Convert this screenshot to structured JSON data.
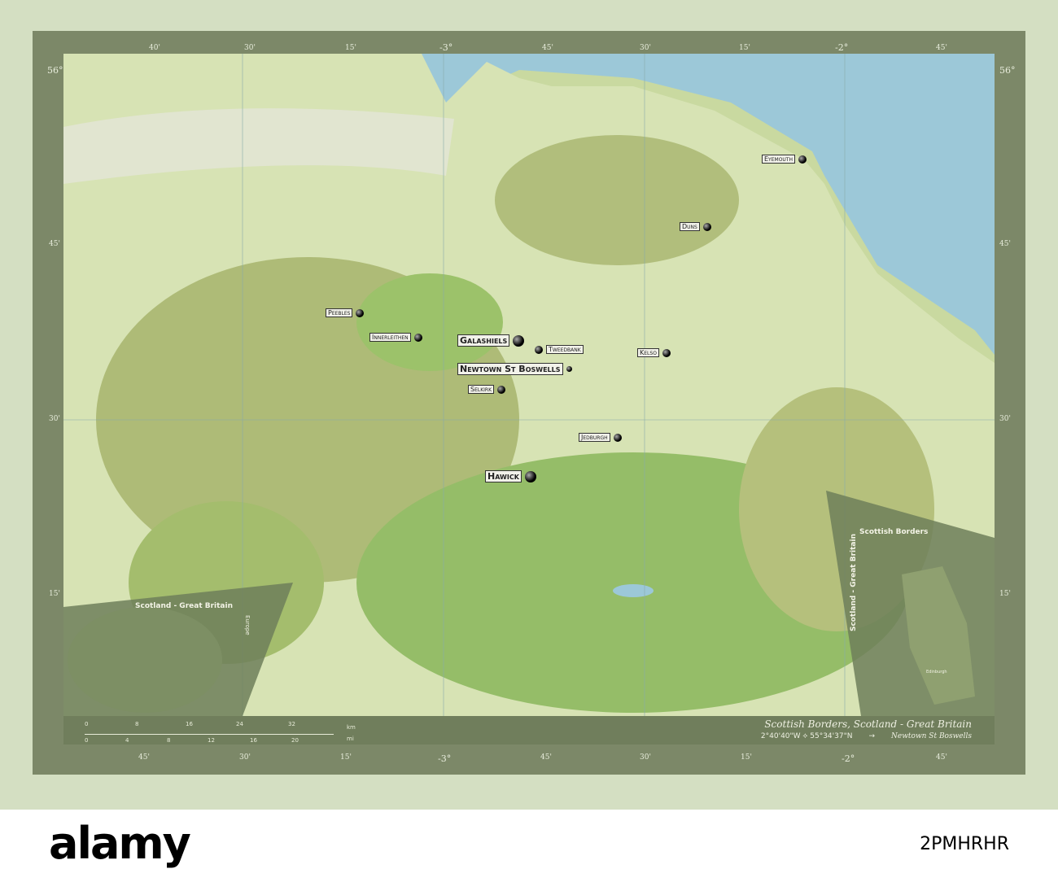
{
  "map": {
    "top_ticks": [
      "40'",
      "30'",
      "15'",
      "-3°",
      "45'",
      "30'",
      "15'",
      "-2°",
      "45'"
    ],
    "bottom_ticks": [
      "45'",
      "30'",
      "15'",
      "-3°",
      "45'",
      "30'",
      "15'",
      "-2°",
      "45'"
    ],
    "left_ticks": [
      "56°",
      "45'",
      "30'",
      "15'"
    ],
    "right_ticks": [
      "56°",
      "45'",
      "30'",
      "15'"
    ],
    "towns": [
      {
        "name": "Eyemouth"
      },
      {
        "name": "Duns"
      },
      {
        "name": "Peebles"
      },
      {
        "name": "Innerleithen"
      },
      {
        "name": "Galashiels"
      },
      {
        "name": "Tweedbank"
      },
      {
        "name": "Kelso"
      },
      {
        "name": "Newtown St Boswells"
      },
      {
        "name": "Selkirk"
      },
      {
        "name": "Jedburgh"
      },
      {
        "name": "Hawick"
      }
    ],
    "colors": {
      "water": "#9cc8d8",
      "land": "#c9d9a0",
      "upland": "#a9b774",
      "forest": "#8fbb64",
      "frame": "#7c8868"
    }
  },
  "inset_left": {
    "title": "Scotland - Great Britain",
    "side_label": "Europe"
  },
  "inset_right": {
    "title": "Scottish Borders",
    "side_label": "Scotland - Great Britain",
    "city": "Edinburgh"
  },
  "scale": {
    "km_ticks": [
      "0",
      "8",
      "16",
      "24",
      "32"
    ],
    "km_unit": "km",
    "mi_ticks": [
      "0",
      "4",
      "8",
      "12",
      "16",
      "20"
    ],
    "mi_unit": "mi"
  },
  "caption": {
    "title": "Scottish Borders, Scotland - Great Britain",
    "coords": "2°40'40\"W ⟡ 55°34'37\"N",
    "arrow": "→",
    "place": "Newtown St Boswells"
  },
  "watermark": {
    "brand": "alamy",
    "image_id": "2PMHRHR"
  }
}
